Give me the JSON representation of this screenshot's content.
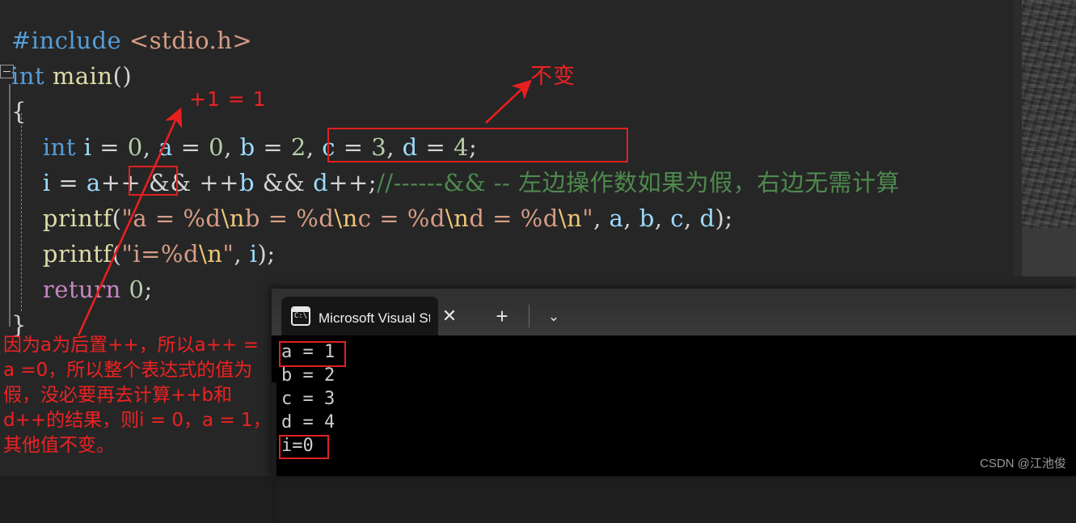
{
  "editor": {
    "code_lines": [
      {
        "id": "l1",
        "tokens": [
          {
            "t": "#include",
            "c": "kw"
          },
          {
            "t": " ",
            "c": "pun"
          },
          {
            "t": "<stdio.h>",
            "c": "str"
          }
        ]
      },
      {
        "id": "l2",
        "tokens": [
          {
            "t": "int",
            "c": "kw"
          },
          {
            "t": " ",
            "c": "pun"
          },
          {
            "t": "main",
            "c": "fn"
          },
          {
            "t": "()",
            "c": "pun"
          }
        ]
      },
      {
        "id": "l3",
        "tokens": [
          {
            "t": "{",
            "c": "pun"
          }
        ]
      },
      {
        "id": "l4",
        "tokens": [
          {
            "t": "    ",
            "c": "pun"
          },
          {
            "t": "int",
            "c": "kw"
          },
          {
            "t": " ",
            "c": "pun"
          },
          {
            "t": "i",
            "c": "var"
          },
          {
            "t": " = ",
            "c": "pun"
          },
          {
            "t": "0",
            "c": "num"
          },
          {
            "t": ", ",
            "c": "pun"
          },
          {
            "t": "a",
            "c": "var"
          },
          {
            "t": " = ",
            "c": "pun"
          },
          {
            "t": "0",
            "c": "num"
          },
          {
            "t": ", ",
            "c": "pun"
          },
          {
            "t": "b",
            "c": "var"
          },
          {
            "t": " = ",
            "c": "pun"
          },
          {
            "t": "2",
            "c": "num"
          },
          {
            "t": ", ",
            "c": "pun"
          },
          {
            "t": "c",
            "c": "var"
          },
          {
            "t": " = ",
            "c": "pun"
          },
          {
            "t": "3",
            "c": "num"
          },
          {
            "t": ", ",
            "c": "pun"
          },
          {
            "t": "d",
            "c": "var"
          },
          {
            "t": " = ",
            "c": "pun"
          },
          {
            "t": "4",
            "c": "num"
          },
          {
            "t": ";",
            "c": "pun"
          }
        ]
      },
      {
        "id": "l5",
        "tokens": [
          {
            "t": "    ",
            "c": "pun"
          },
          {
            "t": "i",
            "c": "var"
          },
          {
            "t": " = ",
            "c": "pun"
          },
          {
            "t": "a",
            "c": "var"
          },
          {
            "t": "++ && ++",
            "c": "pun"
          },
          {
            "t": "b",
            "c": "var"
          },
          {
            "t": " && ",
            "c": "pun"
          },
          {
            "t": "d",
            "c": "var"
          },
          {
            "t": "++;",
            "c": "pun"
          },
          {
            "t": "//------&& -- 左边操作数如果为假，右边无需计算",
            "c": "cmt"
          }
        ]
      },
      {
        "id": "l6",
        "tokens": [
          {
            "t": "    ",
            "c": "pun"
          },
          {
            "t": "printf",
            "c": "fn"
          },
          {
            "t": "(",
            "c": "pun"
          },
          {
            "t": "\"a = %d",
            "c": "str"
          },
          {
            "t": "\\n",
            "c": "esc"
          },
          {
            "t": "b = %d",
            "c": "str"
          },
          {
            "t": "\\n",
            "c": "esc"
          },
          {
            "t": "c = %d",
            "c": "str"
          },
          {
            "t": "\\n",
            "c": "esc"
          },
          {
            "t": "d = %d",
            "c": "str"
          },
          {
            "t": "\\n",
            "c": "esc"
          },
          {
            "t": "\"",
            "c": "str"
          },
          {
            "t": ", ",
            "c": "pun"
          },
          {
            "t": "a",
            "c": "var"
          },
          {
            "t": ", ",
            "c": "pun"
          },
          {
            "t": "b",
            "c": "var"
          },
          {
            "t": ", ",
            "c": "pun"
          },
          {
            "t": "c",
            "c": "var"
          },
          {
            "t": ", ",
            "c": "pun"
          },
          {
            "t": "d",
            "c": "var"
          },
          {
            "t": ");",
            "c": "pun"
          }
        ]
      },
      {
        "id": "l7",
        "tokens": [
          {
            "t": "    ",
            "c": "pun"
          },
          {
            "t": "printf",
            "c": "fn"
          },
          {
            "t": "(",
            "c": "pun"
          },
          {
            "t": "\"i=%d",
            "c": "str"
          },
          {
            "t": "\\n",
            "c": "esc"
          },
          {
            "t": "\"",
            "c": "str"
          },
          {
            "t": ", ",
            "c": "pun"
          },
          {
            "t": "i",
            "c": "var"
          },
          {
            "t": ");",
            "c": "pun"
          }
        ]
      },
      {
        "id": "l8",
        "tokens": [
          {
            "t": "    ",
            "c": "pun"
          },
          {
            "t": "return",
            "c": "kw2"
          },
          {
            "t": " ",
            "c": "pun"
          },
          {
            "t": "0",
            "c": "num"
          },
          {
            "t": ";",
            "c": "pun"
          }
        ]
      },
      {
        "id": "l9",
        "tokens": [
          {
            "t": "}",
            "c": "pun"
          }
        ]
      }
    ],
    "colors": {
      "background": "#262626",
      "keyword": "#569CD6",
      "control_keyword": "#C586C0",
      "function": "#DCDCAA",
      "variable": "#9CDCFE",
      "number": "#B5CEA8",
      "string": "#D69D85",
      "escape": "#F0C674",
      "comment": "#4E8A4E",
      "punctuation": "#d4d4d4"
    }
  },
  "annotations": {
    "color": "#ee2222",
    "plus_one": "+1 = 1",
    "bubian": "不变",
    "paragraph": "因为a为后置++，所以a++ = a =0，所以整个表达式的值为假，没必要再去计算++b和d++的结果，则i = 0，a = 1，其他值不变。",
    "boxes": [
      {
        "name": "declaration-box",
        "label": "b = 2, c = 3, d = 4;"
      },
      {
        "name": "a-increment-box",
        "label": "a++"
      },
      {
        "name": "console-a-box",
        "label": "a = 1"
      },
      {
        "name": "console-i-box",
        "label": "i=0"
      }
    ]
  },
  "console": {
    "tab_title": "Microsoft Visual Studio 调试控",
    "tab_icon": "console-cmd-icon",
    "close_label": "✕",
    "new_tab_label": "+",
    "dropdown_label": "⌄",
    "output_lines": [
      "a = 1",
      "b = 2",
      "c = 3",
      "d = 4",
      "i=0"
    ]
  },
  "watermark": "CSDN @江池俊"
}
